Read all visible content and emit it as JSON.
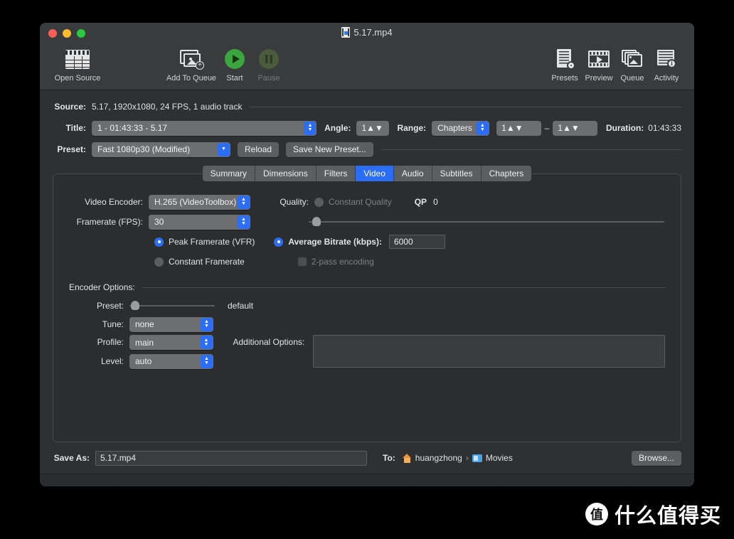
{
  "window": {
    "title": "5.17.mp4",
    "doc_icon": "video-file-icon"
  },
  "toolbar": {
    "left_items": [
      {
        "label": "Open Source",
        "icon": "clapperboard-icon",
        "disabled": false
      },
      {
        "label": "Add To Queue",
        "icon": "add-to-queue-icon",
        "disabled": false
      },
      {
        "label": "Start",
        "icon": "play-circle-icon",
        "disabled": false
      },
      {
        "label": "Pause",
        "icon": "pause-circle-icon",
        "disabled": true
      }
    ],
    "right_items": [
      {
        "label": "Presets",
        "icon": "presets-icon"
      },
      {
        "label": "Preview",
        "icon": "preview-film-icon"
      },
      {
        "label": "Queue",
        "icon": "queue-stack-icon"
      },
      {
        "label": "Activity",
        "icon": "activity-log-icon"
      }
    ]
  },
  "source": {
    "label": "Source:",
    "value": "5.17, 1920x1080, 24 FPS, 1 audio track"
  },
  "title_row": {
    "label": "Title:",
    "value": "1 - 01:43:33 - 5.17",
    "angle_label": "Angle:",
    "angle_value": "1",
    "range_label": "Range:",
    "range_type": "Chapters",
    "range_start": "1",
    "range_dash": "–",
    "range_end": "1",
    "duration_label": "Duration:",
    "duration_value": "01:43:33"
  },
  "preset_row": {
    "label": "Preset:",
    "value": "Fast 1080p30 (Modified)",
    "reload_label": "Reload",
    "save_new_label": "Save New Preset..."
  },
  "tabs": [
    {
      "label": "Summary",
      "active": false
    },
    {
      "label": "Dimensions",
      "active": false
    },
    {
      "label": "Filters",
      "active": false
    },
    {
      "label": "Video",
      "active": true
    },
    {
      "label": "Audio",
      "active": false
    },
    {
      "label": "Subtitles",
      "active": false
    },
    {
      "label": "Chapters",
      "active": false
    }
  ],
  "video": {
    "encoder_label": "Video Encoder:",
    "encoder_value": "H.265 (VideoToolbox)",
    "framerate_label": "Framerate (FPS):",
    "framerate_value": "30",
    "peak_framerate_label": "Peak Framerate (VFR)",
    "peak_framerate_selected": true,
    "constant_framerate_label": "Constant Framerate",
    "constant_framerate_selected": false,
    "quality_label": "Quality:",
    "constant_quality_label": "Constant Quality",
    "constant_quality_selected": false,
    "qp_label": "QP",
    "qp_value": "0",
    "quality_slider_percent": 1,
    "avg_bitrate_label": "Average Bitrate (kbps):",
    "avg_bitrate_selected": true,
    "avg_bitrate_value": "6000",
    "two_pass_label": "2-pass encoding",
    "two_pass_checked": false
  },
  "encoder_options": {
    "section_label": "Encoder Options:",
    "preset_label": "Preset:",
    "preset_slider_percent": 2,
    "preset_value": "default",
    "tune_label": "Tune:",
    "tune_value": "none",
    "profile_label": "Profile:",
    "profile_value": "main",
    "level_label": "Level:",
    "level_value": "auto",
    "additional_options_label": "Additional Options:",
    "additional_options_value": ""
  },
  "save": {
    "save_as_label": "Save As:",
    "save_as_value": "5.17.mp4",
    "to_label": "To:",
    "path_home": "huangzhong",
    "path_separator": "›",
    "path_folder": "Movies",
    "browse_label": "Browse..."
  },
  "watermark": {
    "badge": "值",
    "text": "什么值得买"
  },
  "colors": {
    "accent_blue": "#2b6ef5",
    "window_bg": "#2e3032",
    "panel_bg": "#2b2d2f",
    "toolbar_bg": "#393b3d",
    "start_green": "#3aa63f"
  }
}
